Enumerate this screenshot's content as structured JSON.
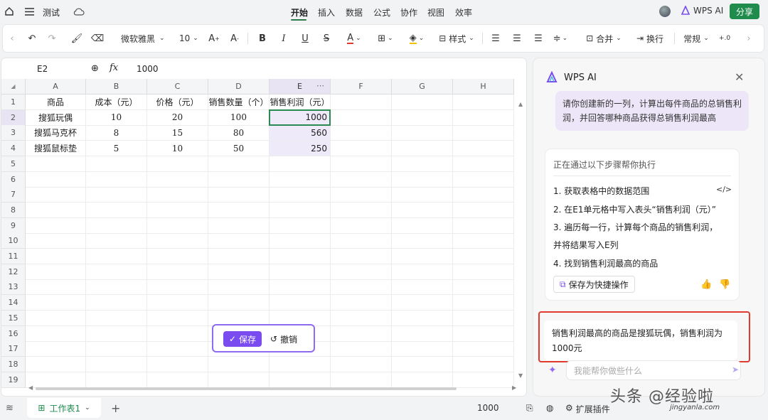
{
  "menubar": {
    "doc_title": "测试",
    "menus": [
      "开始",
      "插入",
      "数据",
      "公式",
      "协作",
      "视图",
      "效率"
    ],
    "active_menu": "开始",
    "ai_label": "WPS AI",
    "share_label": "分享"
  },
  "toolbar": {
    "font_name": "微软雅黑",
    "font_size": "10",
    "styles_label": "样式",
    "merge_label": "合并",
    "wrap_label": "换行",
    "format_label": "常规"
  },
  "formula_bar": {
    "cell_ref": "E2",
    "fx_symbol": "fx",
    "value": "1000"
  },
  "sheet": {
    "columns": [
      "A",
      "B",
      "C",
      "D",
      "E",
      "F",
      "G",
      "H"
    ],
    "rows": [
      "1",
      "2",
      "3",
      "4",
      "5",
      "6",
      "7",
      "8",
      "9",
      "10",
      "11",
      "12",
      "13",
      "14",
      "15",
      "16",
      "17",
      "18",
      "19"
    ],
    "header_row": [
      "商品",
      "成本（元）",
      "价格（元）",
      "销售数量（个）",
      "销售利润（元）"
    ],
    "data": [
      [
        "搜狐玩偶",
        "10",
        "20",
        "100",
        "1000"
      ],
      [
        "搜狐马克杯",
        "8",
        "15",
        "80",
        "560"
      ],
      [
        "搜狐鼠标垫",
        "5",
        "10",
        "50",
        "250"
      ]
    ],
    "selected_cell": "E2",
    "selected_column": "E"
  },
  "floating_actions": {
    "save_label": "保存",
    "undo_label": "撤销"
  },
  "ai_panel": {
    "title": "WPS AI",
    "user_message": "请你创建新的一列，计算出每件商品的总销售利润，并回答哪种商品获得总销售利润最高",
    "steps_header": "正在通过以下步骤帮你执行",
    "steps": [
      "1. 获取表格中的数据范围",
      "2. 在E1单元格中写入表头“销售利润（元）”",
      "3. 遍历每一行，计算每个商品的销售利润，",
      "并将结果写入E列",
      "4. 找到销售利润最高的商品"
    ],
    "quick_action_label": "保存为快捷操作",
    "answer": "销售利润最高的商品是搜狐玩偶，销售利润为1000元",
    "input_placeholder": "我能帮你做些什么"
  },
  "statusbar": {
    "sheet_tab": "工作表1",
    "sum_value": "1000",
    "plugins_label": "扩展插件"
  },
  "watermark": {
    "text": "头条 @经验啦",
    "sub": "jingyanla.com"
  },
  "colors": {
    "accent_green": "#1f8b4c",
    "ai_purple": "#7a4cf0",
    "highlight_red": "#e03a2e"
  },
  "icons": [
    "home-icon",
    "menu-icon",
    "cloud-sync-icon",
    "undo-icon",
    "redo-icon",
    "format-painter-icon",
    "eraser-icon",
    "bold-icon",
    "italic-icon",
    "underline-icon",
    "strikethrough-icon",
    "font-color-icon",
    "border-icon",
    "fill-color-icon",
    "align-left-icon",
    "align-center-icon",
    "align-right-icon",
    "vertical-align-icon",
    "merge-icon",
    "wrap-icon",
    "decimal-icon",
    "zoom-icon",
    "close-icon",
    "code-icon",
    "thumb-up-icon",
    "thumb-down-icon",
    "send-icon",
    "layers-icon",
    "add-sheet-icon"
  ]
}
